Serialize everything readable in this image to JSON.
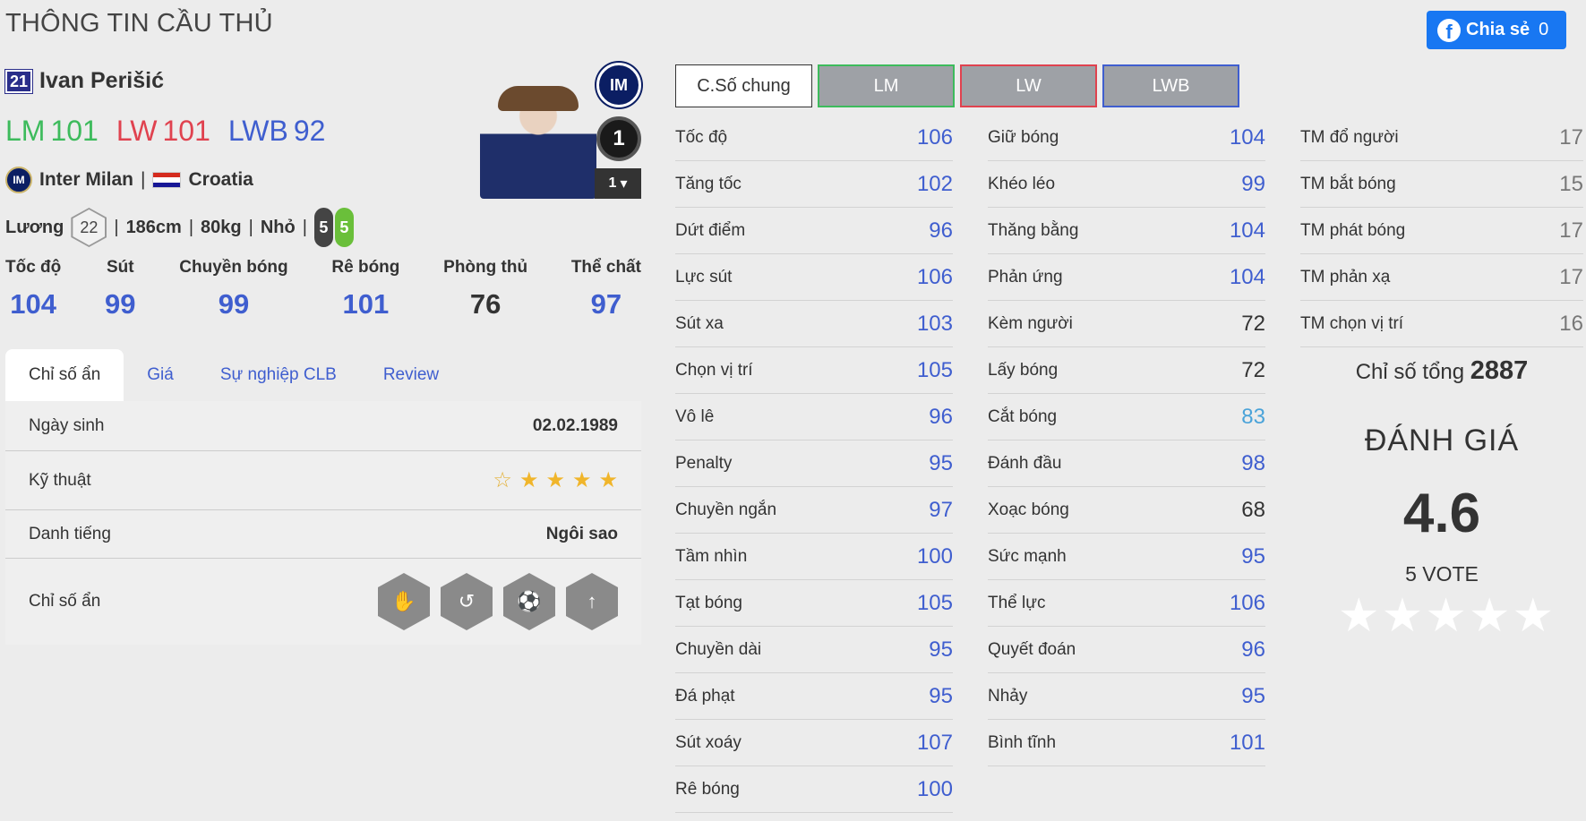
{
  "page_title": "THÔNG TIN CẦU THỦ",
  "share": {
    "label": "Chia sẻ",
    "count": "0"
  },
  "player": {
    "number": "21",
    "name": "Ivan Perišić",
    "positions": [
      {
        "pos": "LM",
        "ovr": "101",
        "color": "#3dbb5c"
      },
      {
        "pos": "LW",
        "ovr": "101",
        "color": "#e0424f"
      },
      {
        "pos": "LWB",
        "ovr": "92",
        "color": "#3f5ecf"
      }
    ],
    "club": "Inter Milan",
    "club_short": "IM",
    "nation": "Croatia",
    "salary_label": "Lương",
    "salary": "22",
    "height": "186cm",
    "weight": "80kg",
    "body": "Nhỏ",
    "weak_foot_left": "5",
    "weak_foot_right": "5",
    "rank": "1",
    "upgrade": "1"
  },
  "main_stats": [
    {
      "label": "Tốc độ",
      "value": "104",
      "color": "#3f5ecf"
    },
    {
      "label": "Sút",
      "value": "99",
      "color": "#3f5ecf"
    },
    {
      "label": "Chuyền bóng",
      "value": "99",
      "color": "#3f5ecf"
    },
    {
      "label": "Rê bóng",
      "value": "101",
      "color": "#3f5ecf"
    },
    {
      "label": "Phòng thủ",
      "value": "76",
      "color": "#333333"
    },
    {
      "label": "Thể chất",
      "value": "97",
      "color": "#3f5ecf"
    }
  ],
  "tabs": [
    "Chỉ số ẩn",
    "Giá",
    "Sự nghiệp CLB",
    "Review"
  ],
  "details": {
    "birth_label": "Ngày sinh",
    "birth": "02.02.1989",
    "skill_label": "Kỹ thuật",
    "skill_stars": 4,
    "fame_label": "Danh tiếng",
    "fame": "Ngôi sao",
    "hidden_label": "Chỉ số ẩn",
    "hidden_icons": [
      "hand-ball-icon",
      "dribble-icon",
      "goal-shot-icon",
      "long-shot-icon"
    ]
  },
  "position_tabs": [
    "C.Số chung",
    "LM",
    "LW",
    "LWB"
  ],
  "position_tab_colors": [
    "#333333",
    "#3dbb5c",
    "#e0424f",
    "#3f5ecf"
  ],
  "stats_col1": [
    {
      "label": "Tốc độ",
      "value": "106",
      "color": "#3f5ecf"
    },
    {
      "label": "Tăng tốc",
      "value": "102",
      "color": "#3f5ecf"
    },
    {
      "label": "Dứt điểm",
      "value": "96",
      "color": "#3f5ecf"
    },
    {
      "label": "Lực sút",
      "value": "106",
      "color": "#3f5ecf"
    },
    {
      "label": "Sút xa",
      "value": "103",
      "color": "#3f5ecf"
    },
    {
      "label": "Chọn vị trí",
      "value": "105",
      "color": "#3f5ecf"
    },
    {
      "label": "Vô lê",
      "value": "96",
      "color": "#3f5ecf"
    },
    {
      "label": "Penalty",
      "value": "95",
      "color": "#3f5ecf"
    },
    {
      "label": "Chuyền ngắn",
      "value": "97",
      "color": "#3f5ecf"
    },
    {
      "label": "Tầm nhìn",
      "value": "100",
      "color": "#3f5ecf"
    },
    {
      "label": "Tạt bóng",
      "value": "105",
      "color": "#3f5ecf"
    },
    {
      "label": "Chuyền dài",
      "value": "95",
      "color": "#3f5ecf"
    },
    {
      "label": "Đá phạt",
      "value": "95",
      "color": "#3f5ecf"
    },
    {
      "label": "Sút xoáy",
      "value": "107",
      "color": "#3f5ecf"
    },
    {
      "label": "Rê bóng",
      "value": "100",
      "color": "#3f5ecf"
    }
  ],
  "stats_col2": [
    {
      "label": "Giữ bóng",
      "value": "104",
      "color": "#3f5ecf"
    },
    {
      "label": "Khéo léo",
      "value": "99",
      "color": "#3f5ecf"
    },
    {
      "label": "Thăng bằng",
      "value": "104",
      "color": "#3f5ecf"
    },
    {
      "label": "Phản ứng",
      "value": "104",
      "color": "#3f5ecf"
    },
    {
      "label": "Kèm người",
      "value": "72",
      "color": "#333333"
    },
    {
      "label": "Lấy bóng",
      "value": "72",
      "color": "#333333"
    },
    {
      "label": "Cắt bóng",
      "value": "83",
      "color": "#4aa3d9"
    },
    {
      "label": "Đánh đầu",
      "value": "98",
      "color": "#3f5ecf"
    },
    {
      "label": "Xoạc bóng",
      "value": "68",
      "color": "#333333"
    },
    {
      "label": "Sức mạnh",
      "value": "95",
      "color": "#3f5ecf"
    },
    {
      "label": "Thể lực",
      "value": "106",
      "color": "#3f5ecf"
    },
    {
      "label": "Quyết đoán",
      "value": "96",
      "color": "#3f5ecf"
    },
    {
      "label": "Nhảy",
      "value": "95",
      "color": "#3f5ecf"
    },
    {
      "label": "Bình tĩnh",
      "value": "101",
      "color": "#3f5ecf"
    }
  ],
  "stats_col3": [
    {
      "label": "TM đổ người",
      "value": "17",
      "color": "#777777"
    },
    {
      "label": "TM bắt bóng",
      "value": "15",
      "color": "#777777"
    },
    {
      "label": "TM phát bóng",
      "value": "17",
      "color": "#777777"
    },
    {
      "label": "TM phản xạ",
      "value": "17",
      "color": "#777777"
    },
    {
      "label": "TM chọn vị trí",
      "value": "16",
      "color": "#777777"
    }
  ],
  "total": {
    "label": "Chỉ số tổng",
    "value": "2887"
  },
  "rating": {
    "title": "ĐÁNH GIÁ",
    "score": "4.6",
    "votes": "5 VOTE"
  }
}
